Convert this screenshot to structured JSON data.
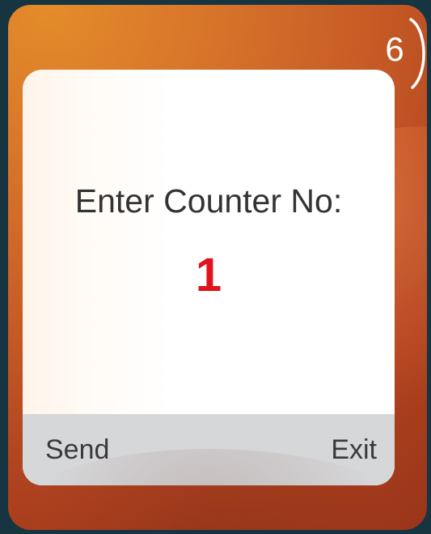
{
  "screen": {
    "timer_value": "6"
  },
  "dialog": {
    "prompt": "Enter Counter No:",
    "counter_value": "1"
  },
  "softkeys": {
    "left": "Send",
    "right": "Exit"
  }
}
